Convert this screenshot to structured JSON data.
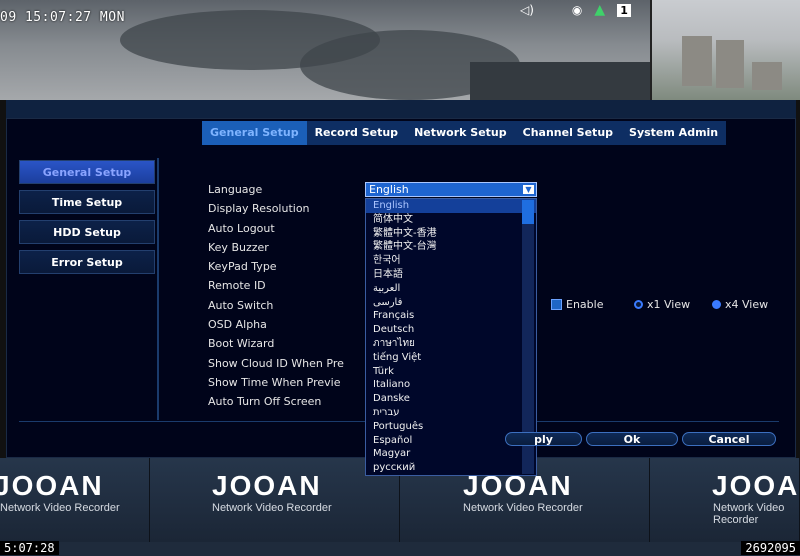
{
  "osd": {
    "top_datetime": "09 15:07:27 MON",
    "bottom_time": "5:07:28",
    "bottom_id": "2692095",
    "status_count": "1"
  },
  "channels": [
    {
      "brand": "JOOAN",
      "sub": "Network Video Recorder"
    },
    {
      "brand": "JOOAN",
      "sub": "Network Video Recorder"
    },
    {
      "brand": "JOOAN",
      "sub": "Network Video Recorder"
    },
    {
      "brand": "JOOAN",
      "sub": "Network Video Recorder"
    }
  ],
  "tabs": [
    "General Setup",
    "Record Setup",
    "Network Setup",
    "Channel Setup",
    "System Admin"
  ],
  "sidebar": [
    "General Setup",
    "Time Setup",
    "HDD Setup",
    "Error Setup"
  ],
  "settings": [
    "Language",
    "Display Resolution",
    "Auto Logout",
    "Key Buzzer",
    "KeyPad Type",
    "Remote ID",
    "Auto Switch",
    "OSD Alpha",
    "Boot Wizard",
    "Show Cloud ID When Pre",
    "Show Time When Previe",
    "Auto Turn Off Screen"
  ],
  "language_select": {
    "value": "English"
  },
  "language_options": [
    "English",
    "简体中文",
    "繁體中文-香港",
    "繁體中文-台灣",
    "한국어",
    "日本語",
    "العربية",
    "فارسی",
    "Français",
    "Deutsch",
    "ภาษาไทย",
    "tiếng Việt",
    "Türk",
    "Italiano",
    "Danske",
    "עברית",
    "Português",
    "Español",
    "Magyar",
    "русский"
  ],
  "auto_switch": {
    "enable_label": "Enable",
    "view1_label": "x1 View",
    "view4_label": "x4 View"
  },
  "buttons": {
    "apply": "ply",
    "ok": "Ok",
    "cancel": "Cancel"
  },
  "colors": {
    "accent": "#1b5fb8",
    "panel": "#00041a",
    "select": "#1e65d0"
  }
}
